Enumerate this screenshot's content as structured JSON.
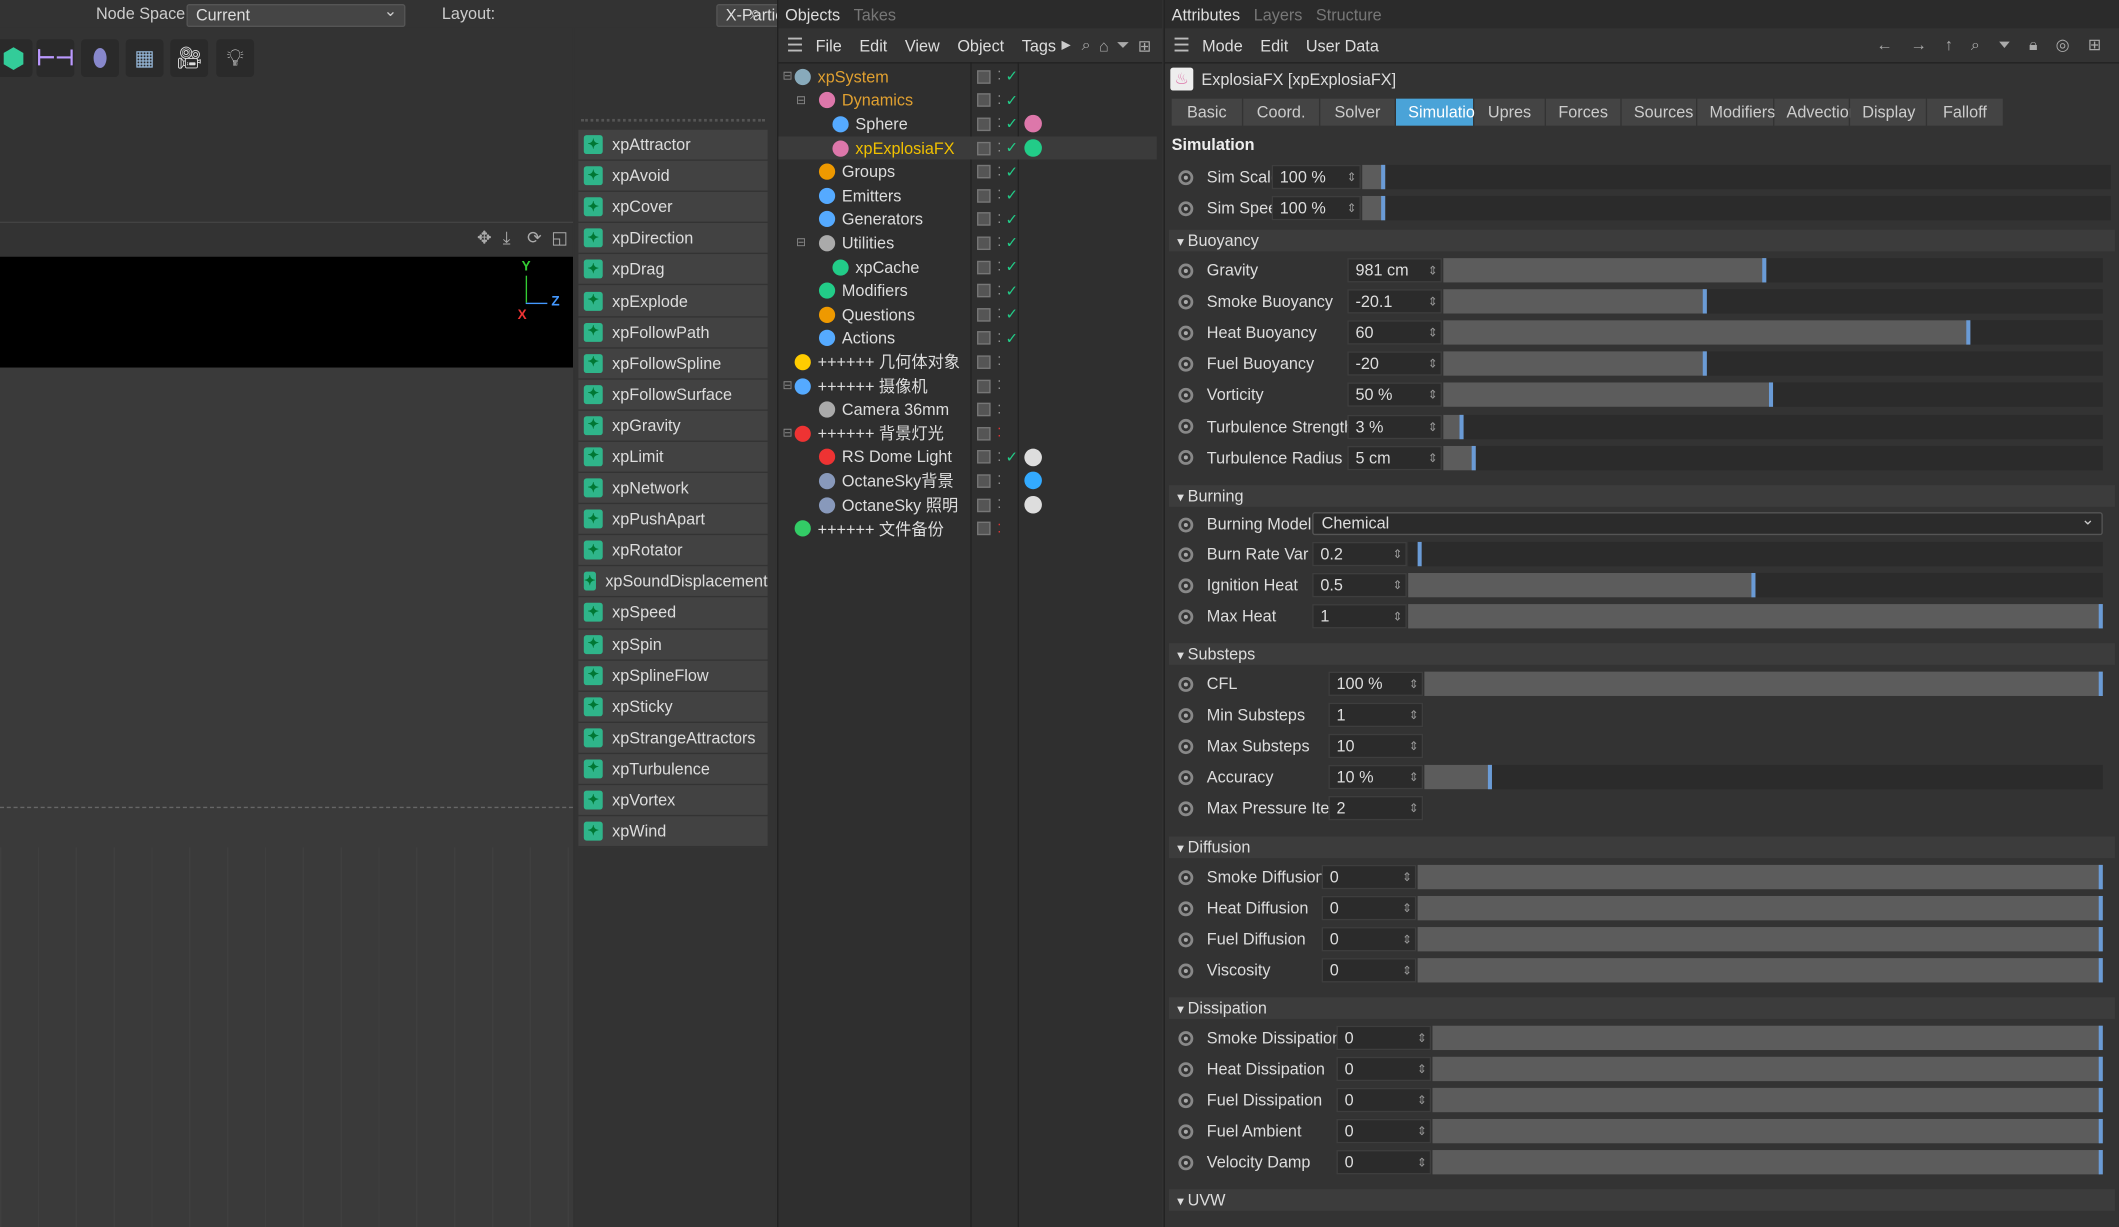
{
  "topbar": {
    "node_space_label": "Node Space:",
    "node_space_value": "Current (Standard/Physical)",
    "layout_label": "Layout:",
    "layout_value": "X-Particles (User)"
  },
  "viewport": {
    "axis_y": "Y",
    "axis_z": "Z",
    "axis_x": "X"
  },
  "effectors": [
    "xpAttractor",
    "xpAvoid",
    "xpCover",
    "xpDirection",
    "xpDrag",
    "xpExplode",
    "xpFollowPath",
    "xpFollowSpline",
    "xpFollowSurface",
    "xpGravity",
    "xpLimit",
    "xpNetwork",
    "xpPushApart",
    "xpRotator",
    "xpSoundDisplacement",
    "xpSpeed",
    "xpSpin",
    "xpSplineFlow",
    "xpSticky",
    "xpStrangeAttractors",
    "xpTurbulence",
    "xpVortex",
    "xpWind"
  ],
  "objects_panel": {
    "tabs": [
      "Objects",
      "Takes"
    ],
    "menu": [
      "File",
      "Edit",
      "View",
      "Object",
      "Tags"
    ],
    "tree": [
      {
        "name": "xpSystem",
        "indent": 0,
        "color": "#e0a030",
        "icon": "#8ab"
      },
      {
        "name": "Dynamics",
        "indent": 1,
        "color": "#e0a030",
        "icon": "#d7a"
      },
      {
        "name": "Sphere",
        "indent": 2,
        "color": "#ddd",
        "icon": "#5af"
      },
      {
        "name": "xpExplosiaFX",
        "indent": 2,
        "color": "#f0c000",
        "icon": "#d7a"
      },
      {
        "name": "Groups",
        "indent": 1,
        "color": "#ddd",
        "icon": "#e90"
      },
      {
        "name": "Emitters",
        "indent": 1,
        "color": "#ddd",
        "icon": "#5af"
      },
      {
        "name": "Generators",
        "indent": 1,
        "color": "#ddd",
        "icon": "#5af"
      },
      {
        "name": "Utilities",
        "indent": 1,
        "color": "#ddd",
        "icon": "#aaa"
      },
      {
        "name": "xpCache",
        "indent": 2,
        "color": "#ddd",
        "icon": "#2c8"
      },
      {
        "name": "Modifiers",
        "indent": 1,
        "color": "#ddd",
        "icon": "#2c8"
      },
      {
        "name": "Questions",
        "indent": 1,
        "color": "#ddd",
        "icon": "#e90"
      },
      {
        "name": "Actions",
        "indent": 1,
        "color": "#ddd",
        "icon": "#5af"
      },
      {
        "name": "++++++ 几何体对象",
        "indent": 0,
        "color": "#ddd",
        "icon": "#fc0"
      },
      {
        "name": "++++++ 摄像机",
        "indent": 0,
        "color": "#ddd",
        "icon": "#5af"
      },
      {
        "name": "Camera 36mm",
        "indent": 1,
        "color": "#ddd",
        "icon": "#aaa"
      },
      {
        "name": "++++++ 背景灯光",
        "indent": 0,
        "color": "#ddd",
        "icon": "#e33"
      },
      {
        "name": "RS Dome Light",
        "indent": 1,
        "color": "#ddd",
        "icon": "#e33"
      },
      {
        "name": "OctaneSky背景",
        "indent": 1,
        "color": "#ddd",
        "icon": "#89b"
      },
      {
        "name": "OctaneSky 照明",
        "indent": 1,
        "color": "#ddd",
        "icon": "#89b"
      },
      {
        "name": "++++++ 文件备份",
        "indent": 0,
        "color": "#ddd",
        "icon": "#3c6"
      }
    ]
  },
  "attributes": {
    "tabs_top": [
      "Attributes",
      "Layers",
      "Structure"
    ],
    "menu": [
      "Mode",
      "Edit",
      "User Data"
    ],
    "object_title": "ExplosiaFX [xpExplosiaFX]",
    "tabs": [
      "Basic",
      "Coord.",
      "Solver",
      "Simulation",
      "Upres",
      "Forces",
      "Sources",
      "Modifiers",
      "Advection",
      "Display",
      "Falloff"
    ],
    "active_tab": "Simulation",
    "section_title": "Simulation",
    "sim_params": [
      {
        "label": "Sim Scale",
        "value": "100 %",
        "level": 0.03
      },
      {
        "label": "Sim Speed",
        "value": "100 %",
        "level": 0.03
      }
    ],
    "buoyancy": {
      "title": "Buoyancy",
      "params": [
        {
          "label": "Gravity",
          "value": "981 cm",
          "level": 0.49
        },
        {
          "label": "Smoke Buoyancy",
          "value": "-20.1",
          "level": 0.4
        },
        {
          "label": "Heat Buoyancy",
          "value": "60",
          "level": 0.8
        },
        {
          "label": "Fuel Buoyancy",
          "value": "-20",
          "level": 0.4
        },
        {
          "label": "Vorticity",
          "value": "50 %",
          "level": 0.5
        },
        {
          "label": "Turbulence Strength",
          "value": "3 %",
          "level": 0.03
        },
        {
          "label": "Turbulence Radius",
          "value": "5 cm",
          "level": 0.05
        }
      ]
    },
    "burning": {
      "title": "Burning",
      "model_label": "Burning Model",
      "model_value": "Chemical",
      "params": [
        {
          "label": "Burn Rate Var",
          "value": "0.2",
          "level": 0.02
        },
        {
          "label": "Ignition Heat",
          "value": "0.5",
          "level": 0.5
        },
        {
          "label": "Max Heat",
          "value": "1",
          "level": 1.0
        }
      ]
    },
    "substeps": {
      "title": "Substeps",
      "params": [
        {
          "label": "CFL",
          "value": "100 %",
          "level": 1.0,
          "slider": true
        },
        {
          "label": "Min Substeps",
          "value": "1",
          "slider": false
        },
        {
          "label": "Max Substeps",
          "value": "10",
          "slider": false
        },
        {
          "label": "Accuracy",
          "value": "10 %",
          "level": 0.1,
          "slider": true
        },
        {
          "label": "Max Pressure Iter",
          "value": "2",
          "slider": false
        }
      ]
    },
    "diffusion": {
      "title": "Diffusion",
      "params": [
        {
          "label": "Smoke Diffusion",
          "value": "0"
        },
        {
          "label": "Heat Diffusion",
          "value": "0"
        },
        {
          "label": "Fuel Diffusion",
          "value": "0"
        },
        {
          "label": "Viscosity",
          "value": "0"
        }
      ]
    },
    "dissipation": {
      "title": "Dissipation",
      "params": [
        {
          "label": "Smoke Dissipation",
          "value": "0"
        },
        {
          "label": "Heat Dissipation",
          "value": "0"
        },
        {
          "label": "Fuel Dissipation",
          "value": "0"
        },
        {
          "label": "Fuel Ambient",
          "value": "0"
        },
        {
          "label": "Velocity Damp",
          "value": "0"
        }
      ]
    },
    "uvw": {
      "title": "UVW"
    }
  }
}
